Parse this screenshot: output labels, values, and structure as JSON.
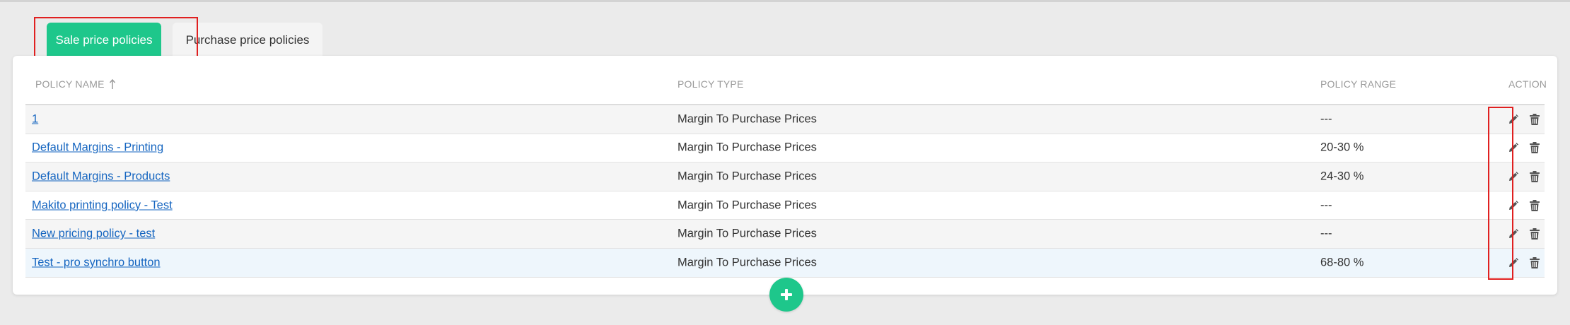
{
  "tabs": [
    {
      "label": "Sale price policies",
      "active": true
    },
    {
      "label": "Purchase price policies",
      "active": false
    }
  ],
  "table": {
    "headers": {
      "name": "POLICY NAME",
      "type": "POLICY TYPE",
      "range": "POLICY RANGE",
      "action": "ACTION"
    },
    "sort_icon": "sort-up-arrow-icon",
    "rows": [
      {
        "name": "1",
        "type": "Margin To Purchase Prices",
        "range": "---"
      },
      {
        "name": "Default Margins - Printing",
        "type": "Margin To Purchase Prices",
        "range": "20-30 %"
      },
      {
        "name": "Default Margins - Products",
        "type": "Margin To Purchase Prices",
        "range": "24-30 %"
      },
      {
        "name": "Makito printing policy - Test",
        "type": "Margin To Purchase Prices",
        "range": "---"
      },
      {
        "name": "New pricing policy - test",
        "type": "Margin To Purchase Prices",
        "range": "---"
      },
      {
        "name": "Test - pro synchro button",
        "type": "Margin To Purchase Prices",
        "range": "68-80 %"
      }
    ]
  },
  "icons": {
    "edit": "pencil-icon",
    "delete": "trash-icon",
    "add": "plus-icon"
  },
  "colors": {
    "accent": "#1ec78b",
    "link": "#1565c0",
    "highlight": "#e02020"
  }
}
